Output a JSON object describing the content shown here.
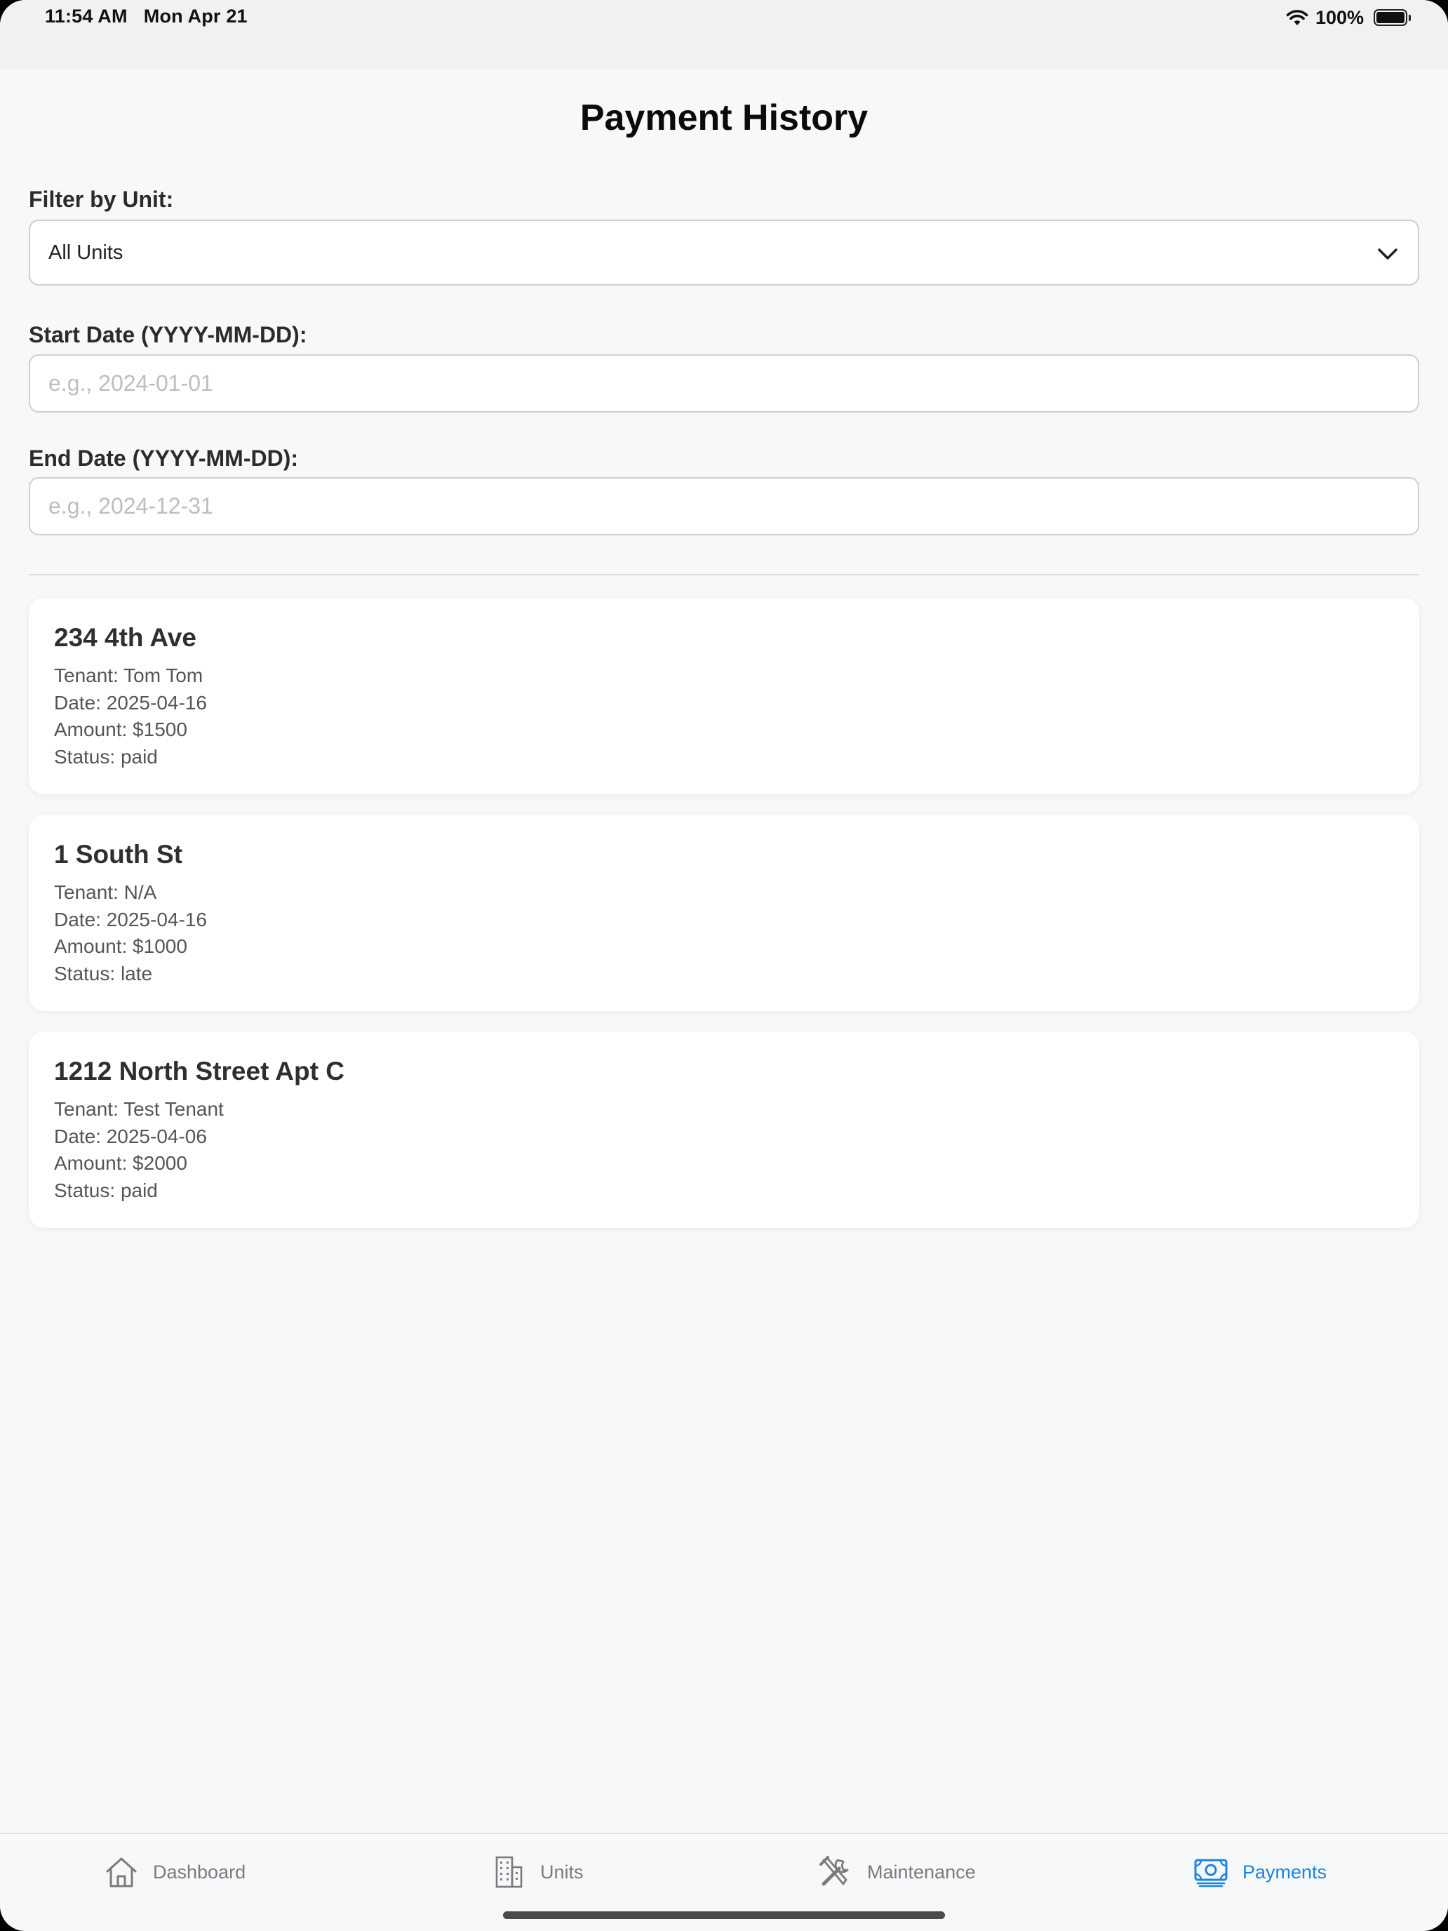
{
  "status_bar": {
    "time": "11:54 AM",
    "date": "Mon Apr 21",
    "battery": "100%"
  },
  "page": {
    "title": "Payment History"
  },
  "filters": {
    "unit_label": "Filter by Unit:",
    "unit_value": "All Units",
    "start_label": "Start Date (YYYY-MM-DD):",
    "start_placeholder": "e.g., 2024-01-01",
    "start_value": "",
    "end_label": "End Date (YYYY-MM-DD):",
    "end_placeholder": "e.g., 2024-12-31",
    "end_value": ""
  },
  "payments": [
    {
      "unit": "234 4th Ave",
      "tenant": "Tenant: Tom Tom",
      "date": "Date: 2025-04-16",
      "amount": "Amount: $1500",
      "status": "Status: paid"
    },
    {
      "unit": "1 South St",
      "tenant": "Tenant: N/A",
      "date": "Date: 2025-04-16",
      "amount": "Amount: $1000",
      "status": "Status: late"
    },
    {
      "unit": "1212 North Street Apt C",
      "tenant": "Tenant: Test Tenant",
      "date": "Date: 2025-04-06",
      "amount": "Amount: $2000",
      "status": "Status: paid"
    }
  ],
  "tab_bar": {
    "tabs": [
      {
        "label": "Dashboard",
        "icon": "house-icon"
      },
      {
        "label": "Units",
        "icon": "building-icon"
      },
      {
        "label": "Maintenance",
        "icon": "tools-icon"
      },
      {
        "label": "Payments",
        "icon": "banknote-icon",
        "active": true
      }
    ],
    "accent_color": "#1a84e2",
    "inactive_color": "#7b7b7e"
  }
}
